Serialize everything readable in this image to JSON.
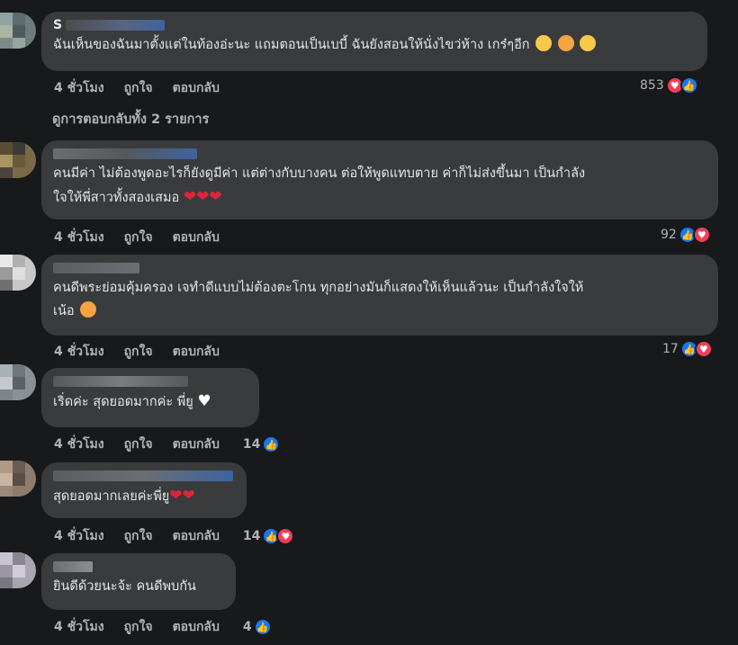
{
  "comments": [
    {
      "name_visible": "S",
      "text_1": "ฉันเห็นของฉันมาตั้งแต่ในท้องอ่ะนะ แถมตอนเป็นเบบี้ ฉันยังสอนให้นั่งไขว่ห้าง เกร๋ๆอีก",
      "time": "4 ชั่วโมง",
      "like_label": "ถูกใจ",
      "reply_label": "ตอบกลับ",
      "reaction_count": "853",
      "reactions": [
        "love-icon",
        "like-icon"
      ]
    },
    {
      "text_1": "คนมีค่า ไม่ต้องพูดอะไรก็ยังดูมีค่า แต่ต่างกับบางคน ต่อให้พูดแทบตาย ค่าก็ไม่ส่งขึ้นมา เป็นกำลัง",
      "text_2": "ใจให้พี่สาวทั้งสองเสมอ",
      "time": "4 ชั่วโมง",
      "like_label": "ถูกใจ",
      "reply_label": "ตอบกลับ",
      "reaction_count": "92",
      "reactions": [
        "like-icon",
        "love-icon"
      ]
    },
    {
      "text_1": "คนดีพระย่อมคุ้มครอง เจทำดีแบบไม่ต้องตะโกน ทุกอย่างมันก็แสดงให้เห็นแล้วนะ เป็นกำลังใจให้",
      "text_2": "เน้อ",
      "time": "4 ชั่วโมง",
      "like_label": "ถูกใจ",
      "reply_label": "ตอบกลับ",
      "reaction_count": "17",
      "reactions": [
        "like-icon",
        "love-icon"
      ]
    },
    {
      "text_1": "เริ่ดค่ะ สุดยอดมากค่ะ พี่ยู",
      "time": "4 ชั่วโมง",
      "like_label": "ถูกใจ",
      "reply_label": "ตอบกลับ",
      "reaction_count": "14",
      "reactions": [
        "like-icon"
      ]
    },
    {
      "text_1": "สุดยอดมากเลยค่ะพี่ยู",
      "time": "4 ชั่วโมง",
      "like_label": "ถูกใจ",
      "reply_label": "ตอบกลับ",
      "reaction_count": "14",
      "reactions": [
        "like-icon",
        "love-icon"
      ]
    },
    {
      "text_1": "ยินดีด้วยนะจ้ะ คนดีพบกัน",
      "time": "4 ชั่วโมง",
      "like_label": "ถูกใจ",
      "reply_label": "ตอบกลับ",
      "reaction_count": "4",
      "reactions": [
        "like-icon"
      ]
    }
  ],
  "view_replies": "ดูการตอบกลับทั้ง 2 รายการ",
  "colors": {
    "background": "#18191a",
    "bubble": "#3a3b3c",
    "like": "#1877f2",
    "love": "#f33e58"
  }
}
